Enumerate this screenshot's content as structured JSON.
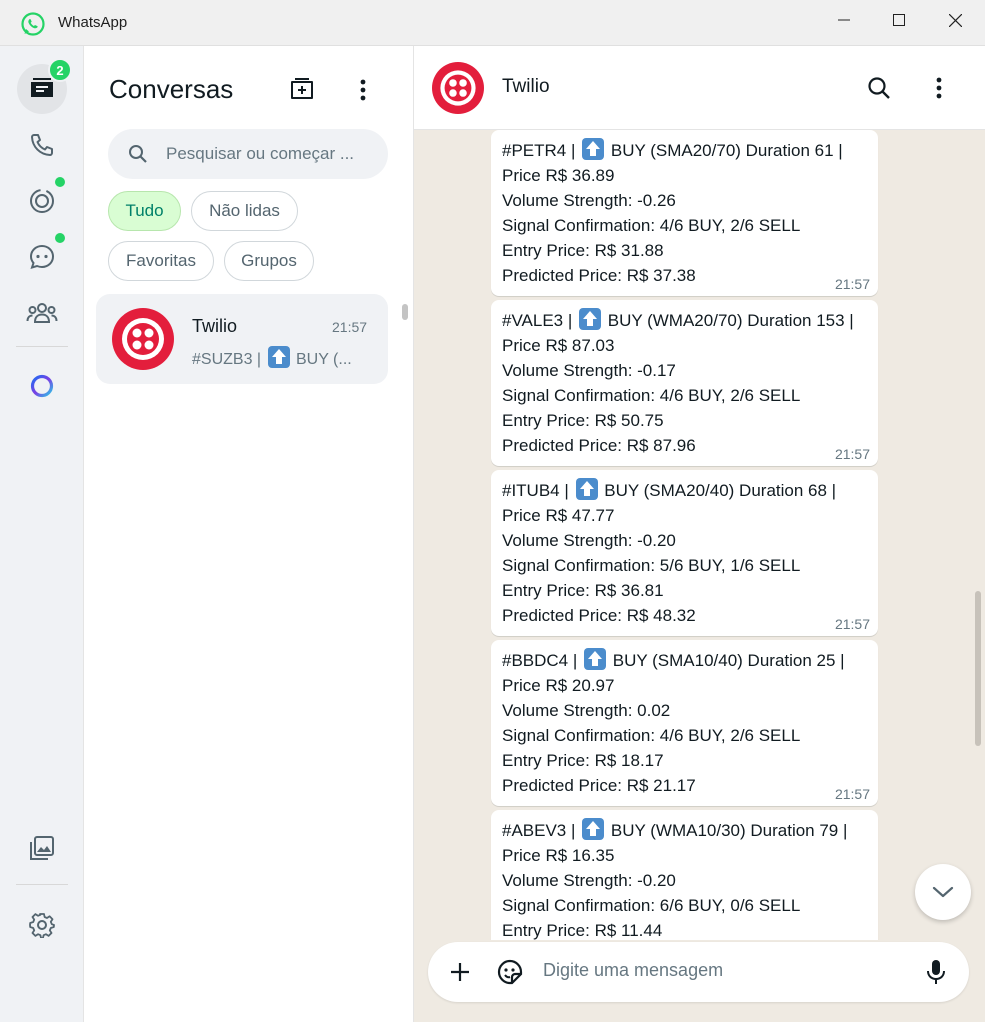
{
  "window": {
    "title": "WhatsApp"
  },
  "rail": {
    "chats_badge": "2"
  },
  "list": {
    "title": "Conversas",
    "search_placeholder": "Pesquisar ou começar ...",
    "filters": [
      "Tudo",
      "Não lidas",
      "Favoritas",
      "Grupos"
    ],
    "chats": [
      {
        "name": "Twilio",
        "time": "21:57",
        "preview_prefix": "#SUZB3 |",
        "preview_suffix": "BUY (..."
      }
    ]
  },
  "chat": {
    "contact_name": "Twilio",
    "messages": [
      {
        "ticker": "#PETR4 |",
        "signal": "BUY (SMA20/70) Duration 61 |",
        "price": "Price R$ 36.89",
        "volume": "Volume Strength: -0.26",
        "confirmation": "Signal Confirmation: 4/6 BUY, 2/6 SELL",
        "entry": "Entry Price: R$ 31.88",
        "predicted": "Predicted Price: R$ 37.38",
        "time": "21:57"
      },
      {
        "ticker": "#VALE3 |",
        "signal": "BUY (WMA20/70) Duration 153 |",
        "price": "Price R$ 87.03",
        "volume": "Volume Strength: -0.17",
        "confirmation": "Signal Confirmation: 4/6 BUY, 2/6 SELL",
        "entry": "Entry Price: R$ 50.75",
        "predicted": "Predicted Price: R$ 87.96",
        "time": "21:57"
      },
      {
        "ticker": "#ITUB4 |",
        "signal": "BUY (SMA20/40) Duration 68 |",
        "price": "Price R$ 47.77",
        "volume": "Volume Strength: -0.20",
        "confirmation": "Signal Confirmation: 5/6 BUY, 1/6 SELL",
        "entry": "Entry Price: R$ 36.81",
        "predicted": "Predicted Price: R$ 48.32",
        "time": "21:57"
      },
      {
        "ticker": "#BBDC4 |",
        "signal": "BUY (SMA10/40) Duration 25 |",
        "price": "Price R$ 20.97",
        "volume": "Volume Strength: 0.02",
        "confirmation": "Signal Confirmation: 4/6 BUY, 2/6 SELL",
        "entry": "Entry Price: R$ 18.17",
        "predicted": "Predicted Price: R$ 21.17",
        "time": "21:57"
      },
      {
        "ticker": "#ABEV3 |",
        "signal": "BUY (WMA10/30) Duration 79 |",
        "price": "Price R$ 16.35",
        "volume": "Volume Strength: -0.20",
        "confirmation": "Signal Confirmation: 6/6 BUY, 0/6 SELL",
        "entry": "Entry Price: R$ 11.44"
      }
    ],
    "composer_placeholder": "Digite uma mensagem"
  },
  "colors": {
    "accent_green": "#25d366",
    "selected_chip_bg": "#d9fdd3",
    "twilio_red": "#e31e3c",
    "chat_bg": "#efeae2"
  }
}
